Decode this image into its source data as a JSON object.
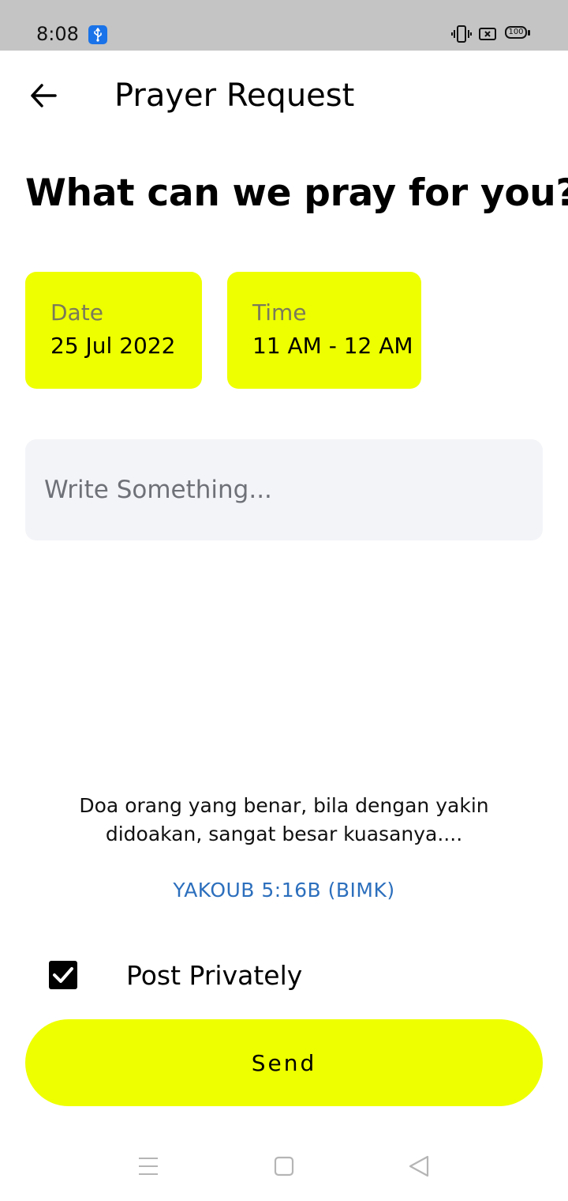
{
  "status_bar": {
    "time": "8:08",
    "battery": "100",
    "icons": [
      "usb-icon",
      "vibrate-icon",
      "screen-x-icon",
      "battery-icon"
    ],
    "usb_color": "#1a73e8"
  },
  "header": {
    "title": "Prayer Request",
    "back_icon": "arrow-left-icon"
  },
  "heading": "What can we pray for you?",
  "cards": {
    "date": {
      "label": "Date",
      "value": "25 Jul 2022"
    },
    "time": {
      "label": "Time",
      "value": "11 AM - 12 AM"
    },
    "color": "#eeff00"
  },
  "input": {
    "placeholder": "Write Something...",
    "value": ""
  },
  "verse": {
    "text": "Doa orang yang benar, bila dengan yakin didoakan, sangat besar kuasanya....",
    "reference": "YAKOUB 5:16B (BIMK)",
    "reference_color": "#2c6fbd"
  },
  "post_privately": {
    "label": "Post Privately",
    "checked": true
  },
  "send_button": {
    "label": "Send",
    "color": "#eeff00"
  },
  "nav_bar": {
    "icons": [
      "menu-icon",
      "home-square-icon",
      "back-triangle-icon"
    ]
  }
}
